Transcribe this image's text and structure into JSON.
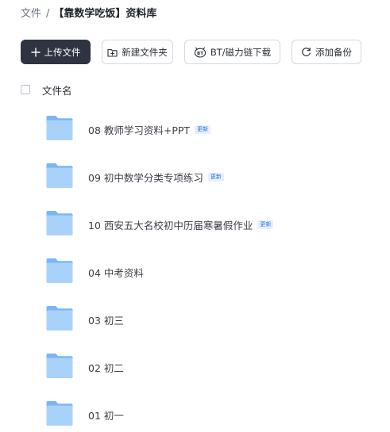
{
  "breadcrumb": {
    "root": "文件",
    "separator": "/",
    "current": "【靠数学吃饭】资料库"
  },
  "toolbar": {
    "upload_label": "上传文件",
    "new_folder_label": "新建文件夹",
    "bt_label": "BT/磁力链下载",
    "backup_label": "添加备份"
  },
  "list_header": {
    "name_column": "文件名"
  },
  "files": [
    {
      "name": "08 教师学习资料+PPT",
      "badge": "更新"
    },
    {
      "name": "09 初中数学分类专项练习",
      "badge": "更新"
    },
    {
      "name": "10 西安五大名校初中历届寒暑假作业",
      "badge": "更新"
    },
    {
      "name": "04 中考资料",
      "badge": ""
    },
    {
      "name": "03 初三",
      "badge": ""
    },
    {
      "name": "02 初二",
      "badge": ""
    },
    {
      "name": "01 初一",
      "badge": ""
    }
  ],
  "colors": {
    "upload_button_bg": "#2f3342",
    "folder_light": "#a9d2fb",
    "folder_dark": "#79b6f5",
    "badge_bg": "#e7f0ff",
    "badge_text": "#2f6fe4"
  },
  "icons": {
    "upload": "plus-icon",
    "new_folder": "folder-plus-icon",
    "bt": "bt-magnet-icon",
    "backup": "refresh-icon",
    "file": "folder-icon"
  }
}
